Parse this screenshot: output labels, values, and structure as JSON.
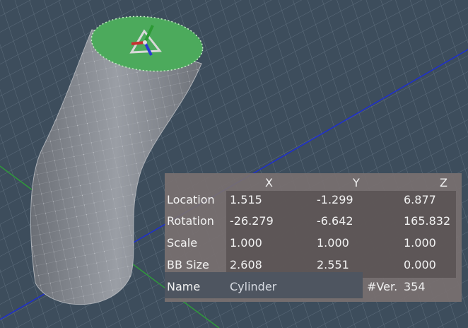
{
  "viewport": {
    "object": "Cylinder mesh with transform gizmo"
  },
  "panel": {
    "columns": [
      "X",
      "Y",
      "Z"
    ],
    "rows": [
      {
        "label": "Location",
        "x": "1.515",
        "y": "-1.299",
        "z": "6.877"
      },
      {
        "label": "Rotation",
        "x": "-26.279",
        "y": "-6.642",
        "z": "165.832"
      },
      {
        "label": "Scale",
        "x": "1.000",
        "y": "1.000",
        "z": "1.000"
      },
      {
        "label": "BB Size",
        "x": "2.608",
        "y": "2.551",
        "z": "0.000"
      }
    ],
    "name_label": "Name",
    "name_value": "Cylinder",
    "vert_label": "#Ver.",
    "vert_count": "354"
  },
  "colors": {
    "grid_bg": "#3d4d5c",
    "mesh": "#8a8e96",
    "selected_face": "#4caa5c",
    "axis_x": "#1e2fd0",
    "axis_y": "#2f9a3a"
  }
}
